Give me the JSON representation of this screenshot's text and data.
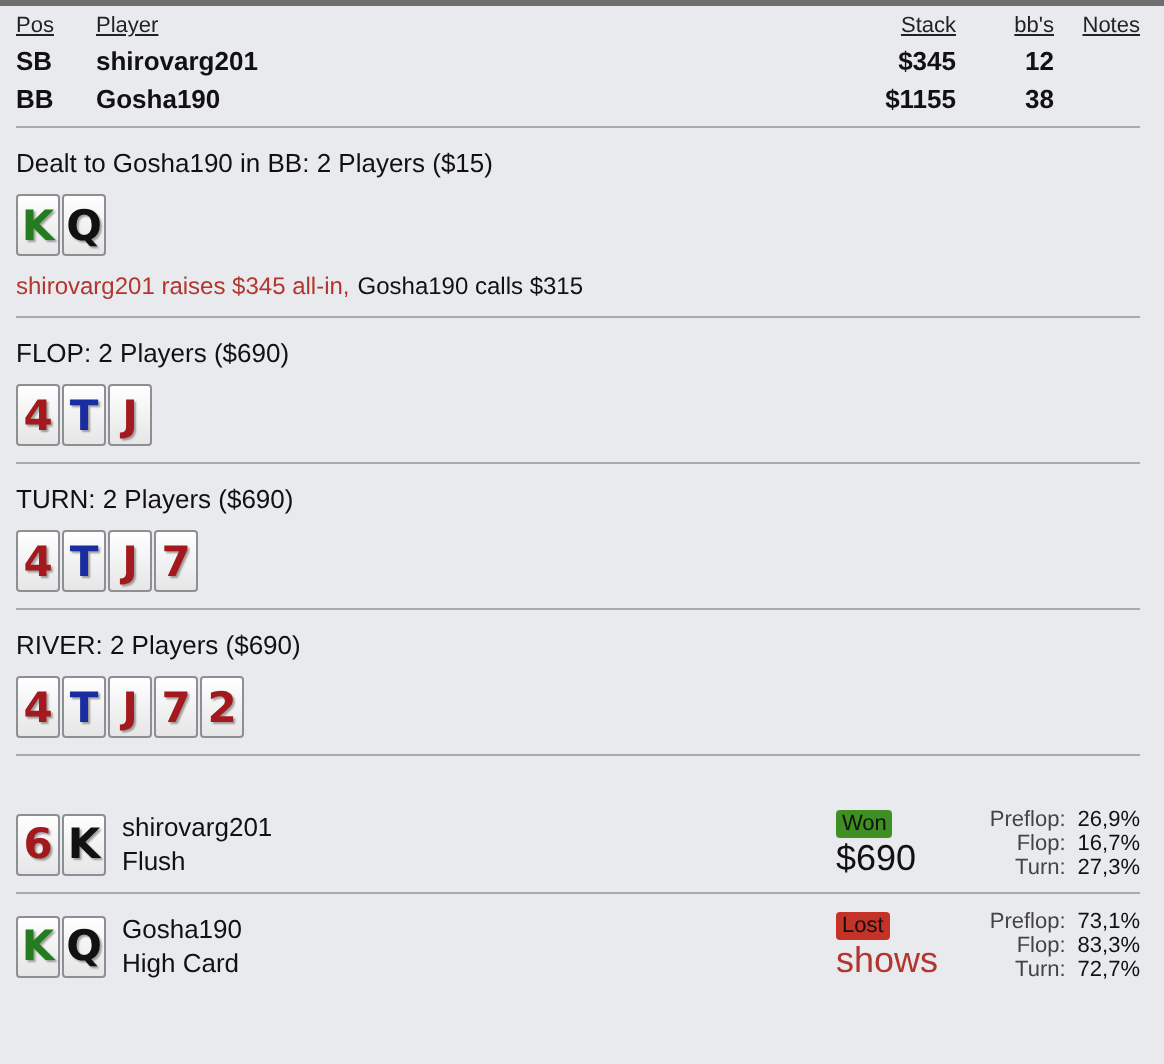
{
  "players_table": {
    "columns": [
      "Pos",
      "Player",
      "Stack",
      "bb's",
      "Notes"
    ],
    "rows": [
      {
        "pos": "SB",
        "player": "shirovarg201",
        "stack": "$345",
        "bbs": "12"
      },
      {
        "pos": "BB",
        "player": "Gosha190",
        "stack": "$1155",
        "bbs": "38"
      }
    ]
  },
  "streets": [
    {
      "title": "Dealt to Gosha190 in BB: 2 Players ($15)",
      "cards": [
        {
          "rank": "K",
          "color": "#237d1f"
        },
        {
          "rank": "Q",
          "color": "#111111"
        }
      ],
      "actions": [
        {
          "text": "shirovarg201 raises $345 all-in,",
          "kind": "aggressive"
        },
        {
          "text": "Gosha190 calls $315",
          "kind": "passive"
        }
      ]
    },
    {
      "title": "FLOP: 2 Players ($690)",
      "cards": [
        {
          "rank": "4",
          "color": "#a3191e"
        },
        {
          "rank": "T",
          "color": "#1a2da0"
        },
        {
          "rank": "J",
          "color": "#a3191e"
        }
      ]
    },
    {
      "title": "TURN: 2 Players ($690)",
      "cards": [
        {
          "rank": "4",
          "color": "#a3191e"
        },
        {
          "rank": "T",
          "color": "#1a2da0"
        },
        {
          "rank": "J",
          "color": "#a3191e"
        },
        {
          "rank": "7",
          "color": "#a3191e"
        }
      ]
    },
    {
      "title": "RIVER: 2 Players ($690)",
      "cards": [
        {
          "rank": "4",
          "color": "#a3191e"
        },
        {
          "rank": "T",
          "color": "#1a2da0"
        },
        {
          "rank": "J",
          "color": "#a3191e"
        },
        {
          "rank": "7",
          "color": "#a3191e"
        },
        {
          "rank": "2",
          "color": "#a3191e"
        }
      ]
    }
  ],
  "showdown": [
    {
      "cards": [
        {
          "rank": "6",
          "color": "#a3191e"
        },
        {
          "rank": "K",
          "color": "#111111"
        }
      ],
      "player": "shirovarg201",
      "hand": "Flush",
      "kind": "won",
      "badge": "Won",
      "amount": "$690",
      "equity": [
        {
          "label": "Preflop:",
          "value": "26,9%"
        },
        {
          "label": "Flop:",
          "value": "16,7%"
        },
        {
          "label": "Turn:",
          "value": "27,3%"
        }
      ]
    },
    {
      "cards": [
        {
          "rank": "K",
          "color": "#237d1f"
        },
        {
          "rank": "Q",
          "color": "#111111"
        }
      ],
      "player": "Gosha190",
      "hand": "High Card",
      "kind": "lost",
      "badge": "Lost",
      "amount": "shows",
      "equity": [
        {
          "label": "Preflop:",
          "value": "73,1%"
        },
        {
          "label": "Flop:",
          "value": "83,3%"
        },
        {
          "label": "Turn:",
          "value": "72,7%"
        }
      ]
    }
  ]
}
